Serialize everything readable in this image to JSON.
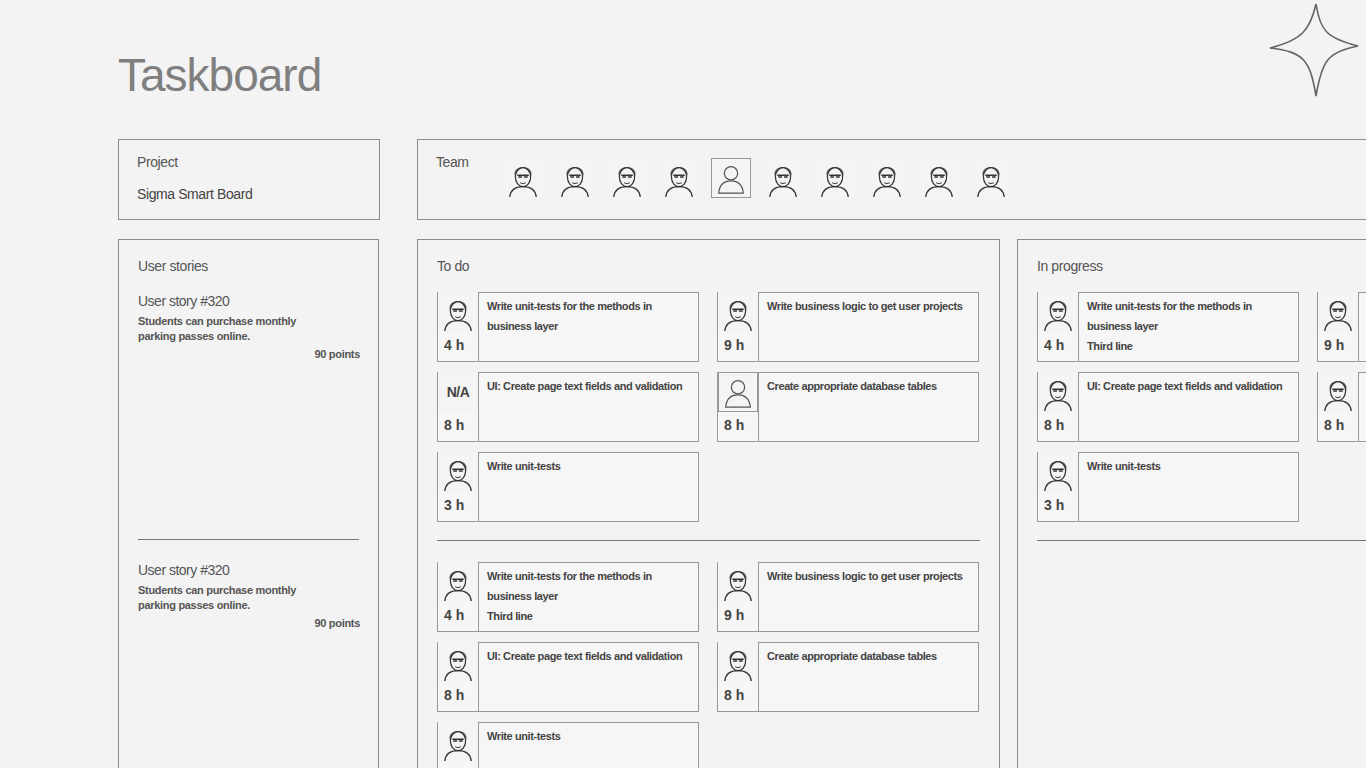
{
  "page": {
    "title": "Taskboard"
  },
  "project": {
    "label": "Project",
    "name": "Sigma Smart Board"
  },
  "team": {
    "label": "Team",
    "members": [
      {
        "kind": "photo"
      },
      {
        "kind": "photo"
      },
      {
        "kind": "photo"
      },
      {
        "kind": "photo"
      },
      {
        "kind": "placeholder"
      },
      {
        "kind": "photo"
      },
      {
        "kind": "photo"
      },
      {
        "kind": "photo"
      },
      {
        "kind": "photo"
      },
      {
        "kind": "photo"
      }
    ]
  },
  "stories_panel": {
    "title": "User stories",
    "stories": [
      {
        "title": "User story #320",
        "description": "Students can purchase monthly parking passes online.",
        "points": "90 points"
      },
      {
        "title": "User story #320",
        "description": "Students can purchase monthly parking passes online.",
        "points": "90 points"
      }
    ]
  },
  "board_columns": [
    {
      "title": "To do",
      "lanes": [
        {
          "cards": [
            {
              "title": "Write unit-tests for the methods in business layer",
              "hours": "4 h",
              "assignee": {
                "kind": "photo"
              }
            },
            {
              "title": "Write business logic to get user projects",
              "hours": "9 h",
              "assignee": {
                "kind": "photo"
              }
            },
            {
              "title": "UI: Create page text fields and validation",
              "hours": "8 h",
              "assignee": {
                "kind": "text",
                "label": "N/A"
              }
            },
            {
              "title": "Create appropriate database tables",
              "hours": "8 h",
              "assignee": {
                "kind": "placeholder"
              }
            },
            {
              "title": "Write unit-tests",
              "hours": "3 h",
              "assignee": {
                "kind": "photo"
              }
            }
          ]
        },
        {
          "cards": [
            {
              "title": "Write unit-tests for the methods in business layer",
              "subtitle": "Third line",
              "hours": "4 h",
              "assignee": {
                "kind": "photo"
              }
            },
            {
              "title": "Write business logic to get user projects",
              "hours": "9 h",
              "assignee": {
                "kind": "photo"
              }
            },
            {
              "title": "UI: Create page text fields and validation",
              "hours": "8 h",
              "assignee": {
                "kind": "photo"
              }
            },
            {
              "title": "Create appropriate database tables",
              "hours": "8 h",
              "assignee": {
                "kind": "photo"
              }
            },
            {
              "title": "Write unit-tests",
              "assignee": {
                "kind": "photo"
              }
            }
          ]
        }
      ]
    },
    {
      "title": "In progress",
      "lanes": [
        {
          "cards": [
            {
              "title": "Write unit-tests for the methods in business layer",
              "subtitle": "Third line",
              "hours": "4 h",
              "assignee": {
                "kind": "photo"
              }
            },
            {
              "title": "",
              "hours": "9 h",
              "assignee": {
                "kind": "photo"
              }
            },
            {
              "title": "UI: Create page text fields and validation",
              "hours": "8 h",
              "assignee": {
                "kind": "photo"
              }
            },
            {
              "title": "",
              "hours": "8 h",
              "assignee": {
                "kind": "photo"
              }
            },
            {
              "title": "Write unit-tests",
              "hours": "3 h",
              "assignee": {
                "kind": "photo"
              }
            }
          ]
        },
        {
          "cards": []
        }
      ]
    }
  ]
}
